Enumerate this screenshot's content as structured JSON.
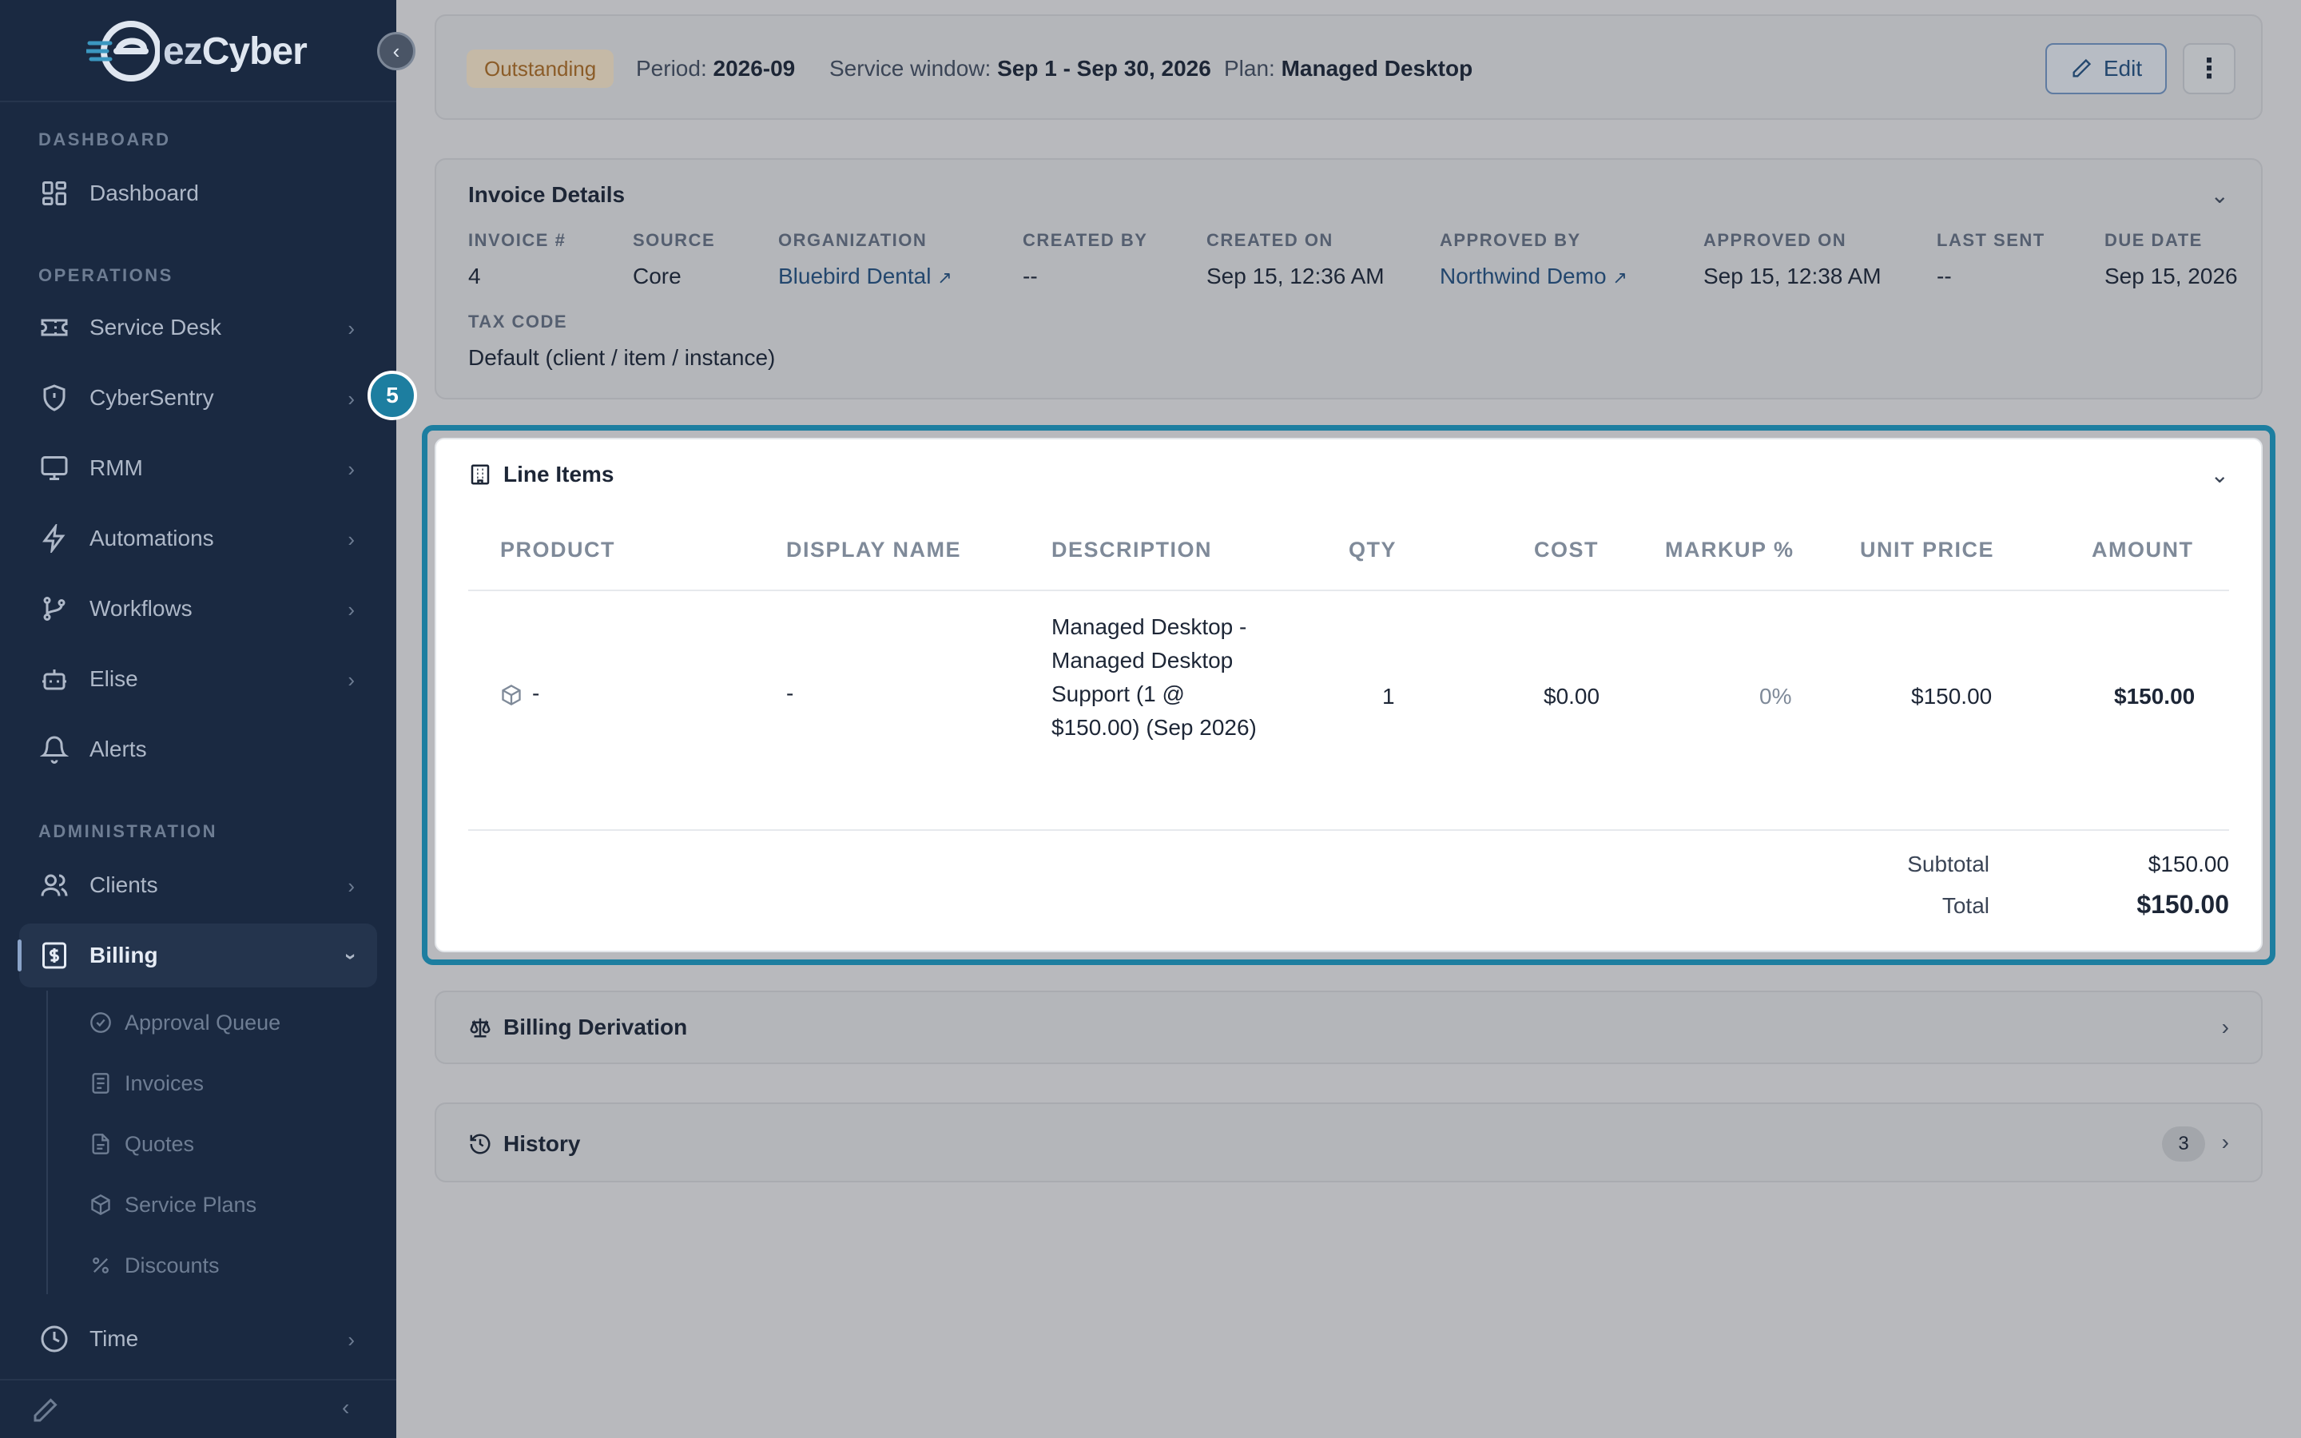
{
  "brand": {
    "name_prefix": "ez",
    "name_suffix": "Cyber"
  },
  "sidebar": {
    "sections": {
      "dashboard": "DASHBOARD",
      "operations": "OPERATIONS",
      "administration": "ADMINISTRATION"
    },
    "items": {
      "dashboard": "Dashboard",
      "service_desk": "Service Desk",
      "cybersentry": "CyberSentry",
      "rmm": "RMM",
      "automations": "Automations",
      "workflows": "Workflows",
      "elise": "Elise",
      "alerts": "Alerts",
      "clients": "Clients",
      "billing": "Billing",
      "time": "Time"
    },
    "billing_sub": {
      "approval_queue": "Approval Queue",
      "invoices": "Invoices",
      "quotes": "Quotes",
      "service_plans": "Service Plans",
      "discounts": "Discounts"
    }
  },
  "status_bar": {
    "status": "Outstanding",
    "period_label": "Period:",
    "period_value": "2026-09",
    "window_label": "Service window:",
    "window_value": "Sep 1 - Sep 30, 2026",
    "plan_label": "Plan:",
    "plan_value": "Managed Desktop",
    "edit_label": "Edit",
    "more_label": "⋮"
  },
  "invoice_details": {
    "title": "Invoice Details",
    "invoice_no": {
      "label": "INVOICE #",
      "value": "4"
    },
    "source": {
      "label": "SOURCE",
      "value": "Core"
    },
    "organization": {
      "label": "ORGANIZATION",
      "value": "Bluebird Dental"
    },
    "created_by": {
      "label": "CREATED BY",
      "value": "--"
    },
    "created_on": {
      "label": "CREATED ON",
      "value": "Sep 15, 12:36 AM"
    },
    "approved_by": {
      "label": "APPROVED BY",
      "value": "Northwind Demo"
    },
    "approved_on": {
      "label": "APPROVED ON",
      "value": "Sep 15, 12:38 AM"
    },
    "last_sent": {
      "label": "LAST SENT",
      "value": "--"
    },
    "due_date": {
      "label": "DUE DATE",
      "value": "Sep 15, 2026"
    },
    "tax_code": {
      "label": "TAX CODE",
      "value": "Default (client / item / instance)"
    }
  },
  "step_badge": "5",
  "line_items": {
    "title": "Line Items",
    "columns": {
      "product": "PRODUCT",
      "display_name": "DISPLAY NAME",
      "description": "DESCRIPTION",
      "qty": "QTY",
      "cost": "COST",
      "markup": "MARKUP %",
      "unit_price": "UNIT PRICE",
      "amount": "AMOUNT"
    },
    "rows": [
      {
        "product": "-",
        "display_name": "-",
        "description": "Managed Desktop - Managed Desktop Support (1 @ $150.00) (Sep 2026)",
        "qty": "1",
        "cost": "$0.00",
        "markup": "0%",
        "unit_price": "$150.00",
        "amount": "$150.00"
      }
    ],
    "subtotal_label": "Subtotal",
    "subtotal_value": "$150.00",
    "total_label": "Total",
    "total_value": "$150.00"
  },
  "billing_derivation": {
    "title": "Billing Derivation"
  },
  "history": {
    "title": "History",
    "count": "3"
  }
}
